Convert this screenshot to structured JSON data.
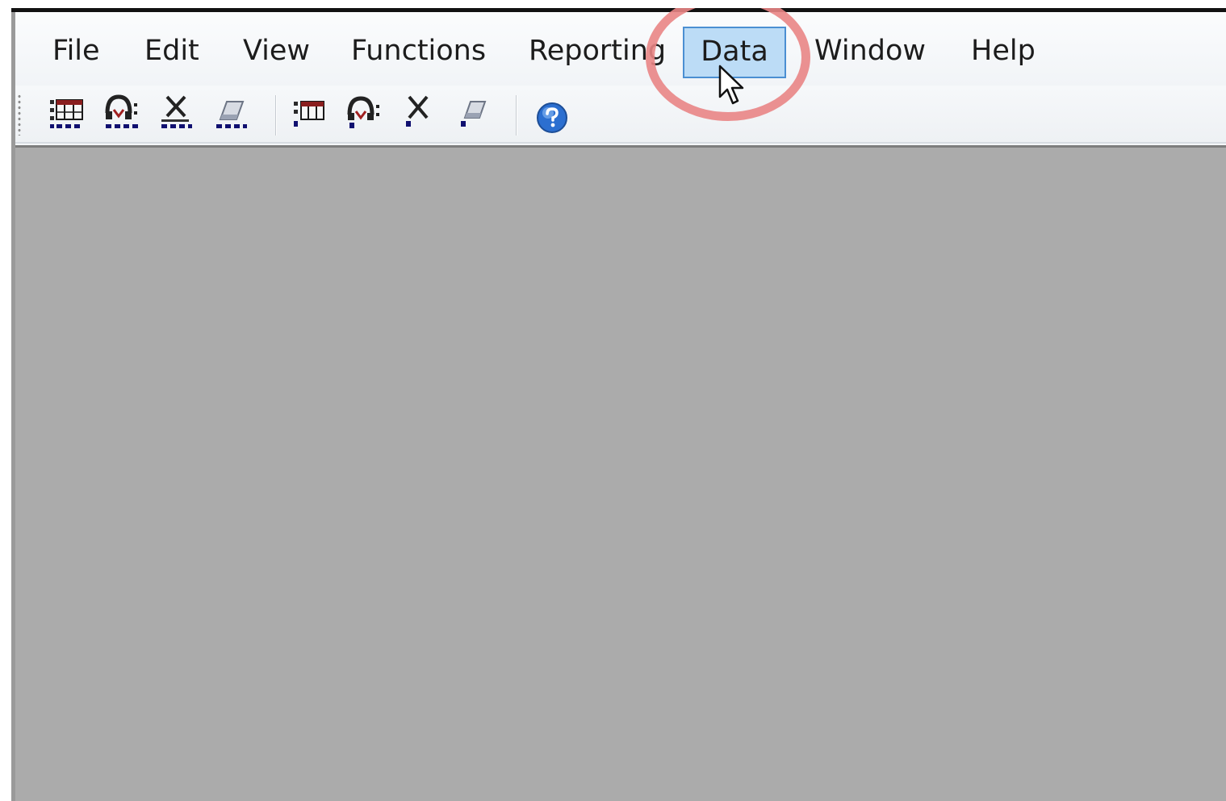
{
  "menubar": {
    "items": [
      {
        "label": "File"
      },
      {
        "label": "Edit"
      },
      {
        "label": "View"
      },
      {
        "label": "Functions"
      },
      {
        "label": "Reporting"
      },
      {
        "label": "Data",
        "state": "hovered"
      },
      {
        "label": "Window"
      },
      {
        "label": "Help"
      }
    ]
  },
  "toolbar": {
    "buttons": [
      {
        "icon": "grid-table-icon",
        "group": 1
      },
      {
        "icon": "person-magnet-icon",
        "group": 1
      },
      {
        "icon": "delete-x-icon",
        "group": 1
      },
      {
        "icon": "eraser-icon",
        "group": 1
      },
      {
        "icon": "grid-table-icon",
        "group": 2
      },
      {
        "icon": "person-magnet-icon",
        "group": 2
      },
      {
        "icon": "delete-x-icon",
        "group": 2
      },
      {
        "icon": "eraser-icon",
        "group": 2
      },
      {
        "icon": "help-icon",
        "group": 3
      }
    ]
  },
  "colors": {
    "menu_hover_fill": "#bcdcf6",
    "menu_hover_border": "#4b8fd2",
    "highlight_ring": "#e98585",
    "client_area": "#ababab",
    "help_icon_blue": "#2c6fd0"
  }
}
